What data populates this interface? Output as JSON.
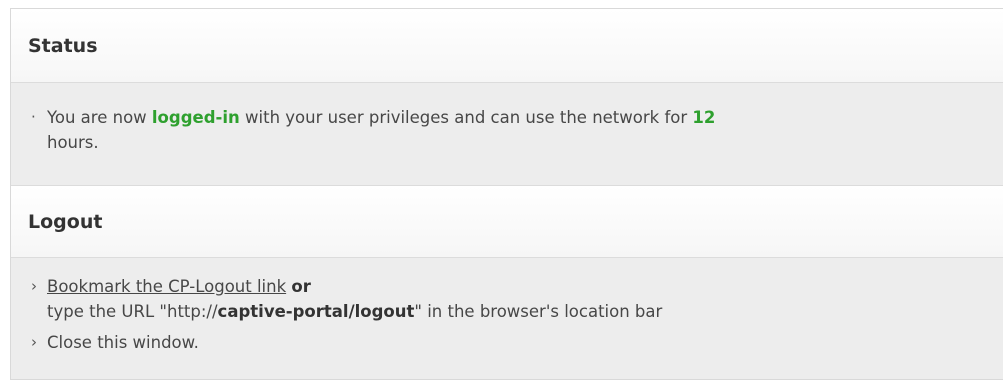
{
  "status": {
    "title": "Status",
    "bullet": "·",
    "text_1": "You are now ",
    "logged_in": "logged-in",
    "text_2": " with your user privileges and can use the network for ",
    "hours_value": "12",
    "text_3": "hours."
  },
  "logout": {
    "title": "Logout",
    "bullet": "›",
    "bookmark_link": "Bookmark the CP-Logout link",
    "or": "or",
    "type_prefix": "type the URL \"http://",
    "url_bold": "captive-portal/logout",
    "type_suffix": "\" in the browser's location bar",
    "close_text": "Close this window."
  },
  "colors": {
    "accent_green": "#2ea02e",
    "body_bg": "#ededed",
    "header_bg": "#f6f6f6"
  }
}
